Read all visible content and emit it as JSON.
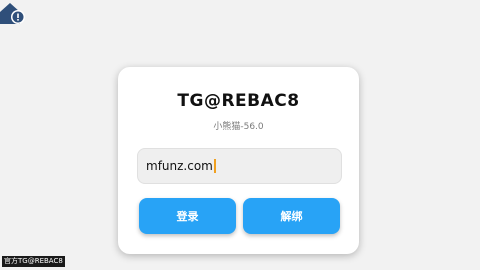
{
  "card": {
    "title": "TG@REBAC8",
    "subtitle": "小熊猫-56.0"
  },
  "input": {
    "value": "mfunz.com"
  },
  "buttons": {
    "login_label": "登录",
    "unbind_label": "解绑"
  },
  "watermark": {
    "text": "官方TG@REBAC8"
  },
  "colors": {
    "accent": "#28a3f6",
    "background": "#f2f2f2",
    "caret": "#f0a020"
  },
  "icons": {
    "status": "house-alert-icon"
  }
}
